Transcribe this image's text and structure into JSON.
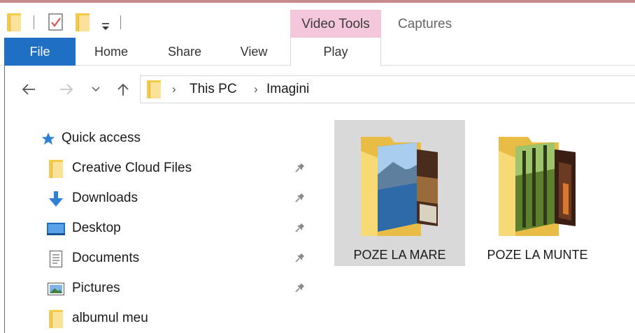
{
  "title_bar": {
    "context_group_label": "Video Tools",
    "window_title": "Captures"
  },
  "ribbon": {
    "tabs": [
      {
        "label": "File",
        "active": true
      },
      {
        "label": "Home"
      },
      {
        "label": "Share"
      },
      {
        "label": "View"
      },
      {
        "label": "Play"
      }
    ]
  },
  "address_bar": {
    "breadcrumb": [
      "This PC",
      "Imagini"
    ]
  },
  "nav_pane": {
    "quick_access_label": "Quick access",
    "items": [
      {
        "label": "Creative Cloud Files",
        "icon": "folder-icon",
        "pinned": true
      },
      {
        "label": "Downloads",
        "icon": "download-arrow-icon",
        "pinned": true
      },
      {
        "label": "Desktop",
        "icon": "desktop-icon",
        "pinned": true
      },
      {
        "label": "Documents",
        "icon": "document-icon",
        "pinned": true
      },
      {
        "label": "Pictures",
        "icon": "pictures-icon",
        "pinned": true
      },
      {
        "label": "albumul meu",
        "icon": "folder-icon",
        "pinned": false
      }
    ]
  },
  "content": {
    "folders": [
      {
        "name": "POZE LA MARE",
        "selected": true
      },
      {
        "name": "POZE LA MUNTE",
        "selected": false
      }
    ]
  },
  "colors": {
    "file_tab": "#1f6fc5",
    "context_group": "#f4c7dc",
    "selection": "#d9d9d9",
    "folder": "#f5c94a",
    "quick_access_star": "#2e7fd6"
  }
}
